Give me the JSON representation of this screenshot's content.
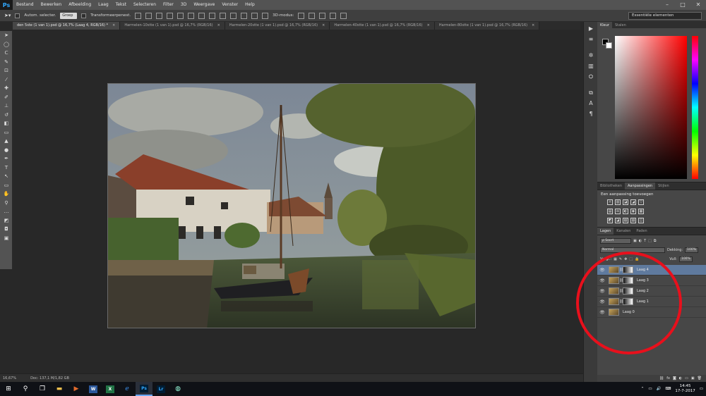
{
  "app": {
    "logo": "Ps"
  },
  "menu": [
    "Bestand",
    "Bewerken",
    "Afbeelding",
    "Laag",
    "Tekst",
    "Selecteren",
    "Filter",
    "3D",
    "Weergave",
    "Venster",
    "Help"
  ],
  "window_controls": {
    "minimize": "–",
    "maximize": "□",
    "close": "✕"
  },
  "options": {
    "auto_select_label": "Autom. selecter.",
    "auto_select_value": "Groep",
    "transform_label": "Transformeerpenest.",
    "mode_label": "3D-modus:",
    "workspace": "Essentiële elementen"
  },
  "tabs": [
    {
      "label": "den 5ste (1 van 1).psd @ 16,7% (Laag 4, RGB/16) *",
      "close": "×"
    },
    {
      "label": "Harmelen-10stte (1 van 1).psd @ 16,7% (RGB/16)",
      "close": "×"
    },
    {
      "label": "Harmelen-20stte (1 van 1).psd @ 16,7% (RGB/16)",
      "close": "×"
    },
    {
      "label": "Harmelen-40stte (1 van 1).psd @ 16,7% (RGB/16)",
      "close": "×"
    },
    {
      "label": "Harmelen-80stte (1 van 1).psd @ 16,7% (RGB/16)",
      "close": "×"
    }
  ],
  "tools": [
    "move-icon",
    "marquee-icon",
    "lasso-icon",
    "quick-select-icon",
    "crop-icon",
    "eyedropper-icon",
    "healing-icon",
    "brush-icon",
    "stamp-icon",
    "history-brush-icon",
    "eraser-icon",
    "gradient-icon",
    "blur-icon",
    "dodge-icon",
    "pen-icon",
    "type-icon",
    "path-select-icon",
    "shape-icon",
    "hand-icon",
    "zoom-icon",
    "edit-toolbar-icon",
    "color-swatches-icon",
    "quickmask-icon",
    "screenmode-icon"
  ],
  "tool_glyphs": [
    "➤",
    "◯",
    "ᑕ",
    "✎",
    "⊡",
    "⁄",
    "✚",
    "✐",
    "⊥",
    "↺",
    "◧",
    "▭",
    "▲",
    "●",
    "✒",
    "T",
    "↖",
    "▭",
    "✋",
    "⚲",
    "…",
    "◩",
    "◘",
    "▣"
  ],
  "status": {
    "zoom": "16,67%",
    "doc": "Doc: 137,1 M/1,82 GB"
  },
  "dock_glyphs": [
    "▶",
    "≡",
    "✲",
    "▥",
    "⛭",
    "⧉",
    "A",
    "¶"
  ],
  "color_panel": {
    "tabs": [
      "Kleur",
      "Stalen"
    ]
  },
  "adjustments": {
    "tabs": [
      "Bibliotheken",
      "Aanpassingen",
      "Stijlen"
    ],
    "title": "Een aanpassing toevoegen",
    "row1": [
      "☼",
      "▥",
      "◪",
      "◢",
      "▽"
    ],
    "row2": [
      "▤",
      "⚖",
      "◐",
      "◉",
      "▦"
    ],
    "row3": [
      "◩",
      "◪",
      "▧",
      "▨",
      "◫"
    ]
  },
  "layers": {
    "tabs": [
      "Lagen",
      "Kanalen",
      "Paden"
    ],
    "kind": "ρ Soort",
    "blend_mode": "Normal",
    "opacity_label": "Dekking:",
    "opacity": "100%",
    "lock_label": "Vergr.:",
    "fill_label": "Vull:",
    "fill": "100%",
    "items": [
      {
        "name": "Laag 4",
        "selected": true
      },
      {
        "name": "Laag 3",
        "selected": false
      },
      {
        "name": "Laag 2",
        "selected": false
      },
      {
        "name": "Laag 1",
        "selected": false
      },
      {
        "name": "Laag 0",
        "selected": false
      }
    ]
  },
  "taskbar": {
    "apps": [
      "W",
      "X",
      "Ps",
      "Lr"
    ],
    "time": "14:45",
    "date": "17-7-2017"
  },
  "colors": {
    "annotation": "#e8101c",
    "selection": "#5f7a9e"
  }
}
